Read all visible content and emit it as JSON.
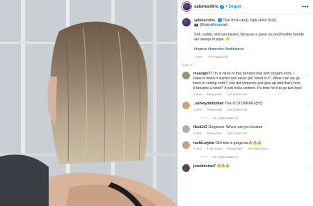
{
  "post": {
    "username": "saloncentric",
    "follow_label": "Seguir",
    "more_label": "•••"
  },
  "caption": {
    "username": "saloncentric",
    "text1": "That fresh-chop, high-shine finish.",
    "mention": "@hairwithhannah",
    "text2": "Soft, subtle, and sun-kissed. Because a great cut and healthy blonde are always in style.",
    "emoji": "💛",
    "hashtags": "#haircut #haircolor #bobhaircut",
    "time": "1 sem",
    "translate": "Ver traducción"
  },
  "sort_label": "Para ti",
  "comments": [
    {
      "username": "msangie77",
      "text": "I'm so tired of that bended look with straight ends. I hated it when it started and never got \"used to it\". When can we go back to curling ends? Like did someone just give up and that's how it became a trend? It just looks undone. It's time for it to go buh-bye!",
      "time": "2 días",
      "reply": "Responder",
      "translate": "Ver traducción",
      "color": "#8a9b7a"
    },
    {
      "username": "_ashleydidmyhair",
      "text": "This is STUNNING😍😍",
      "time": "1 sem",
      "reply": "Responder",
      "translate": "Ver traducción",
      "replies": "Ver respuestas (1)",
      "color": "#d4a373"
    },
    {
      "username": "lika1143",
      "text": "Gorgeous. Where are you located",
      "time": "2 días",
      "reply": "Responder",
      "translate": "Ver traducción",
      "color": "#b0b0b0"
    },
    {
      "username": "rachk.stylist",
      "text": "Ohh this is gorgeous🔥🔥🔥",
      "time": "1 sem",
      "likes": "1 Me gusta",
      "reply": "Responder",
      "translate": "Ver traducción",
      "replies": "Ver respuestas (1)",
      "color": "#c9a27e"
    },
    {
      "username": "jewelmotew7",
      "text": "🔥🔥🔥",
      "color": "#5a4a3a"
    }
  ]
}
